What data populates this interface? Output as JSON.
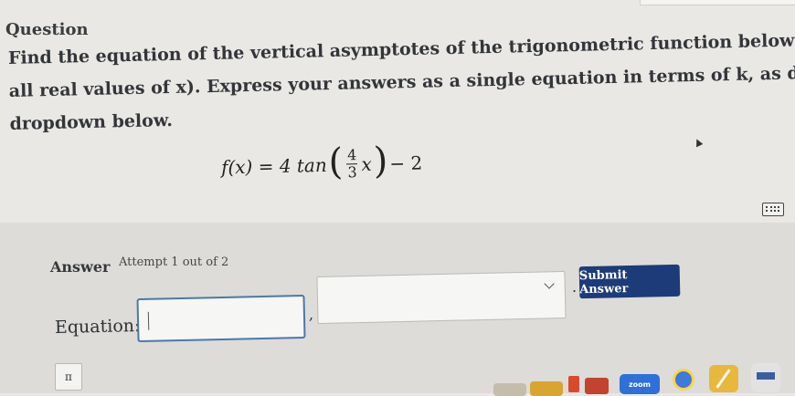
{
  "question": {
    "heading": "Question",
    "text_lines": [
      "Find the equation of the vertical asymptotes of the trigonometric function below in general form (for",
      "all real values of x). Express your answers as a single equation in terms of k, as determined by the",
      "dropdown below."
    ],
    "formula": {
      "lhs": "f(x) = 4 tan",
      "numerator": "4",
      "denominator": "3",
      "var": "x",
      "tail": "− 2"
    }
  },
  "answer": {
    "label": "Answer",
    "attempt": "Attempt 1 out of 2",
    "equation_label": "Equation:",
    "equation_value": "",
    "dropdown_value": "",
    "submit_label": "Submit Answer",
    "pi_key": "π"
  },
  "dock": {
    "zoom_label": "zoom"
  },
  "colors": {
    "submit_bg": "#1d3b78",
    "input_border": "#4d78a8"
  }
}
